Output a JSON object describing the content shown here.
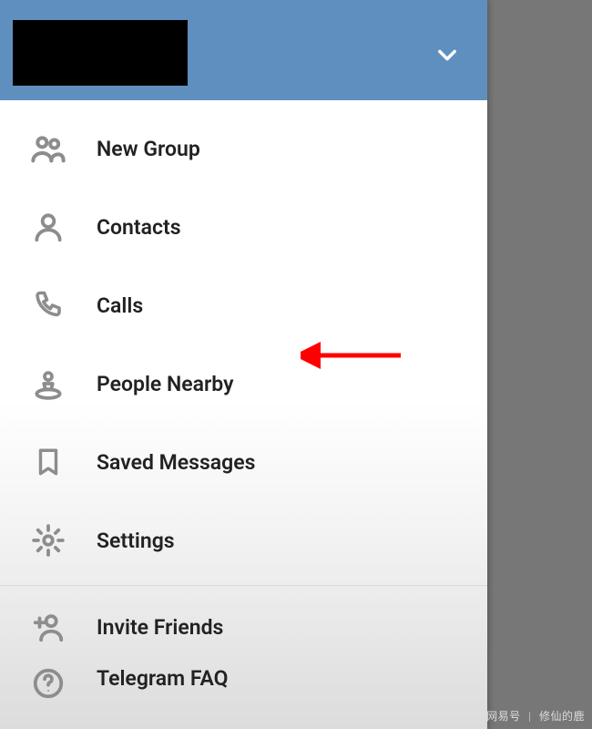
{
  "menu": {
    "items": [
      {
        "label": "New Group"
      },
      {
        "label": "Contacts"
      },
      {
        "label": "Calls"
      },
      {
        "label": "People Nearby"
      },
      {
        "label": "Saved Messages"
      },
      {
        "label": "Settings"
      },
      {
        "label": "Invite Friends"
      },
      {
        "label": "Telegram FAQ"
      }
    ]
  },
  "watermark": {
    "left": "网易号",
    "right": "修仙的鹿"
  }
}
